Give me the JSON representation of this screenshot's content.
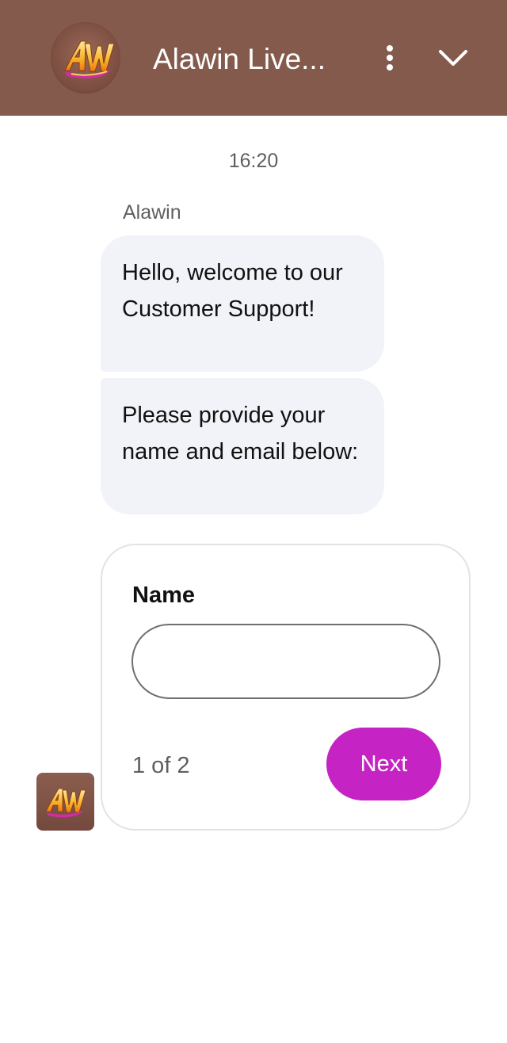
{
  "header": {
    "title": "Alawin Live...",
    "logo_text": "AW",
    "menu_icon": "more-vertical-icon",
    "collapse_icon": "chevron-down-icon",
    "background_color": "#845a4d"
  },
  "chat": {
    "timestamp": "16:20",
    "sender": "Alawin",
    "messages": [
      {
        "text": "Hello, welcome to our Customer Support!"
      },
      {
        "text": "Please provide your name and email below:"
      }
    ]
  },
  "form": {
    "field_label": "Name",
    "input_value": "",
    "input_placeholder": "",
    "step_text": "1 of 2",
    "next_label": "Next",
    "next_color": "#c523c3"
  },
  "avatar": {
    "text": "AW"
  }
}
